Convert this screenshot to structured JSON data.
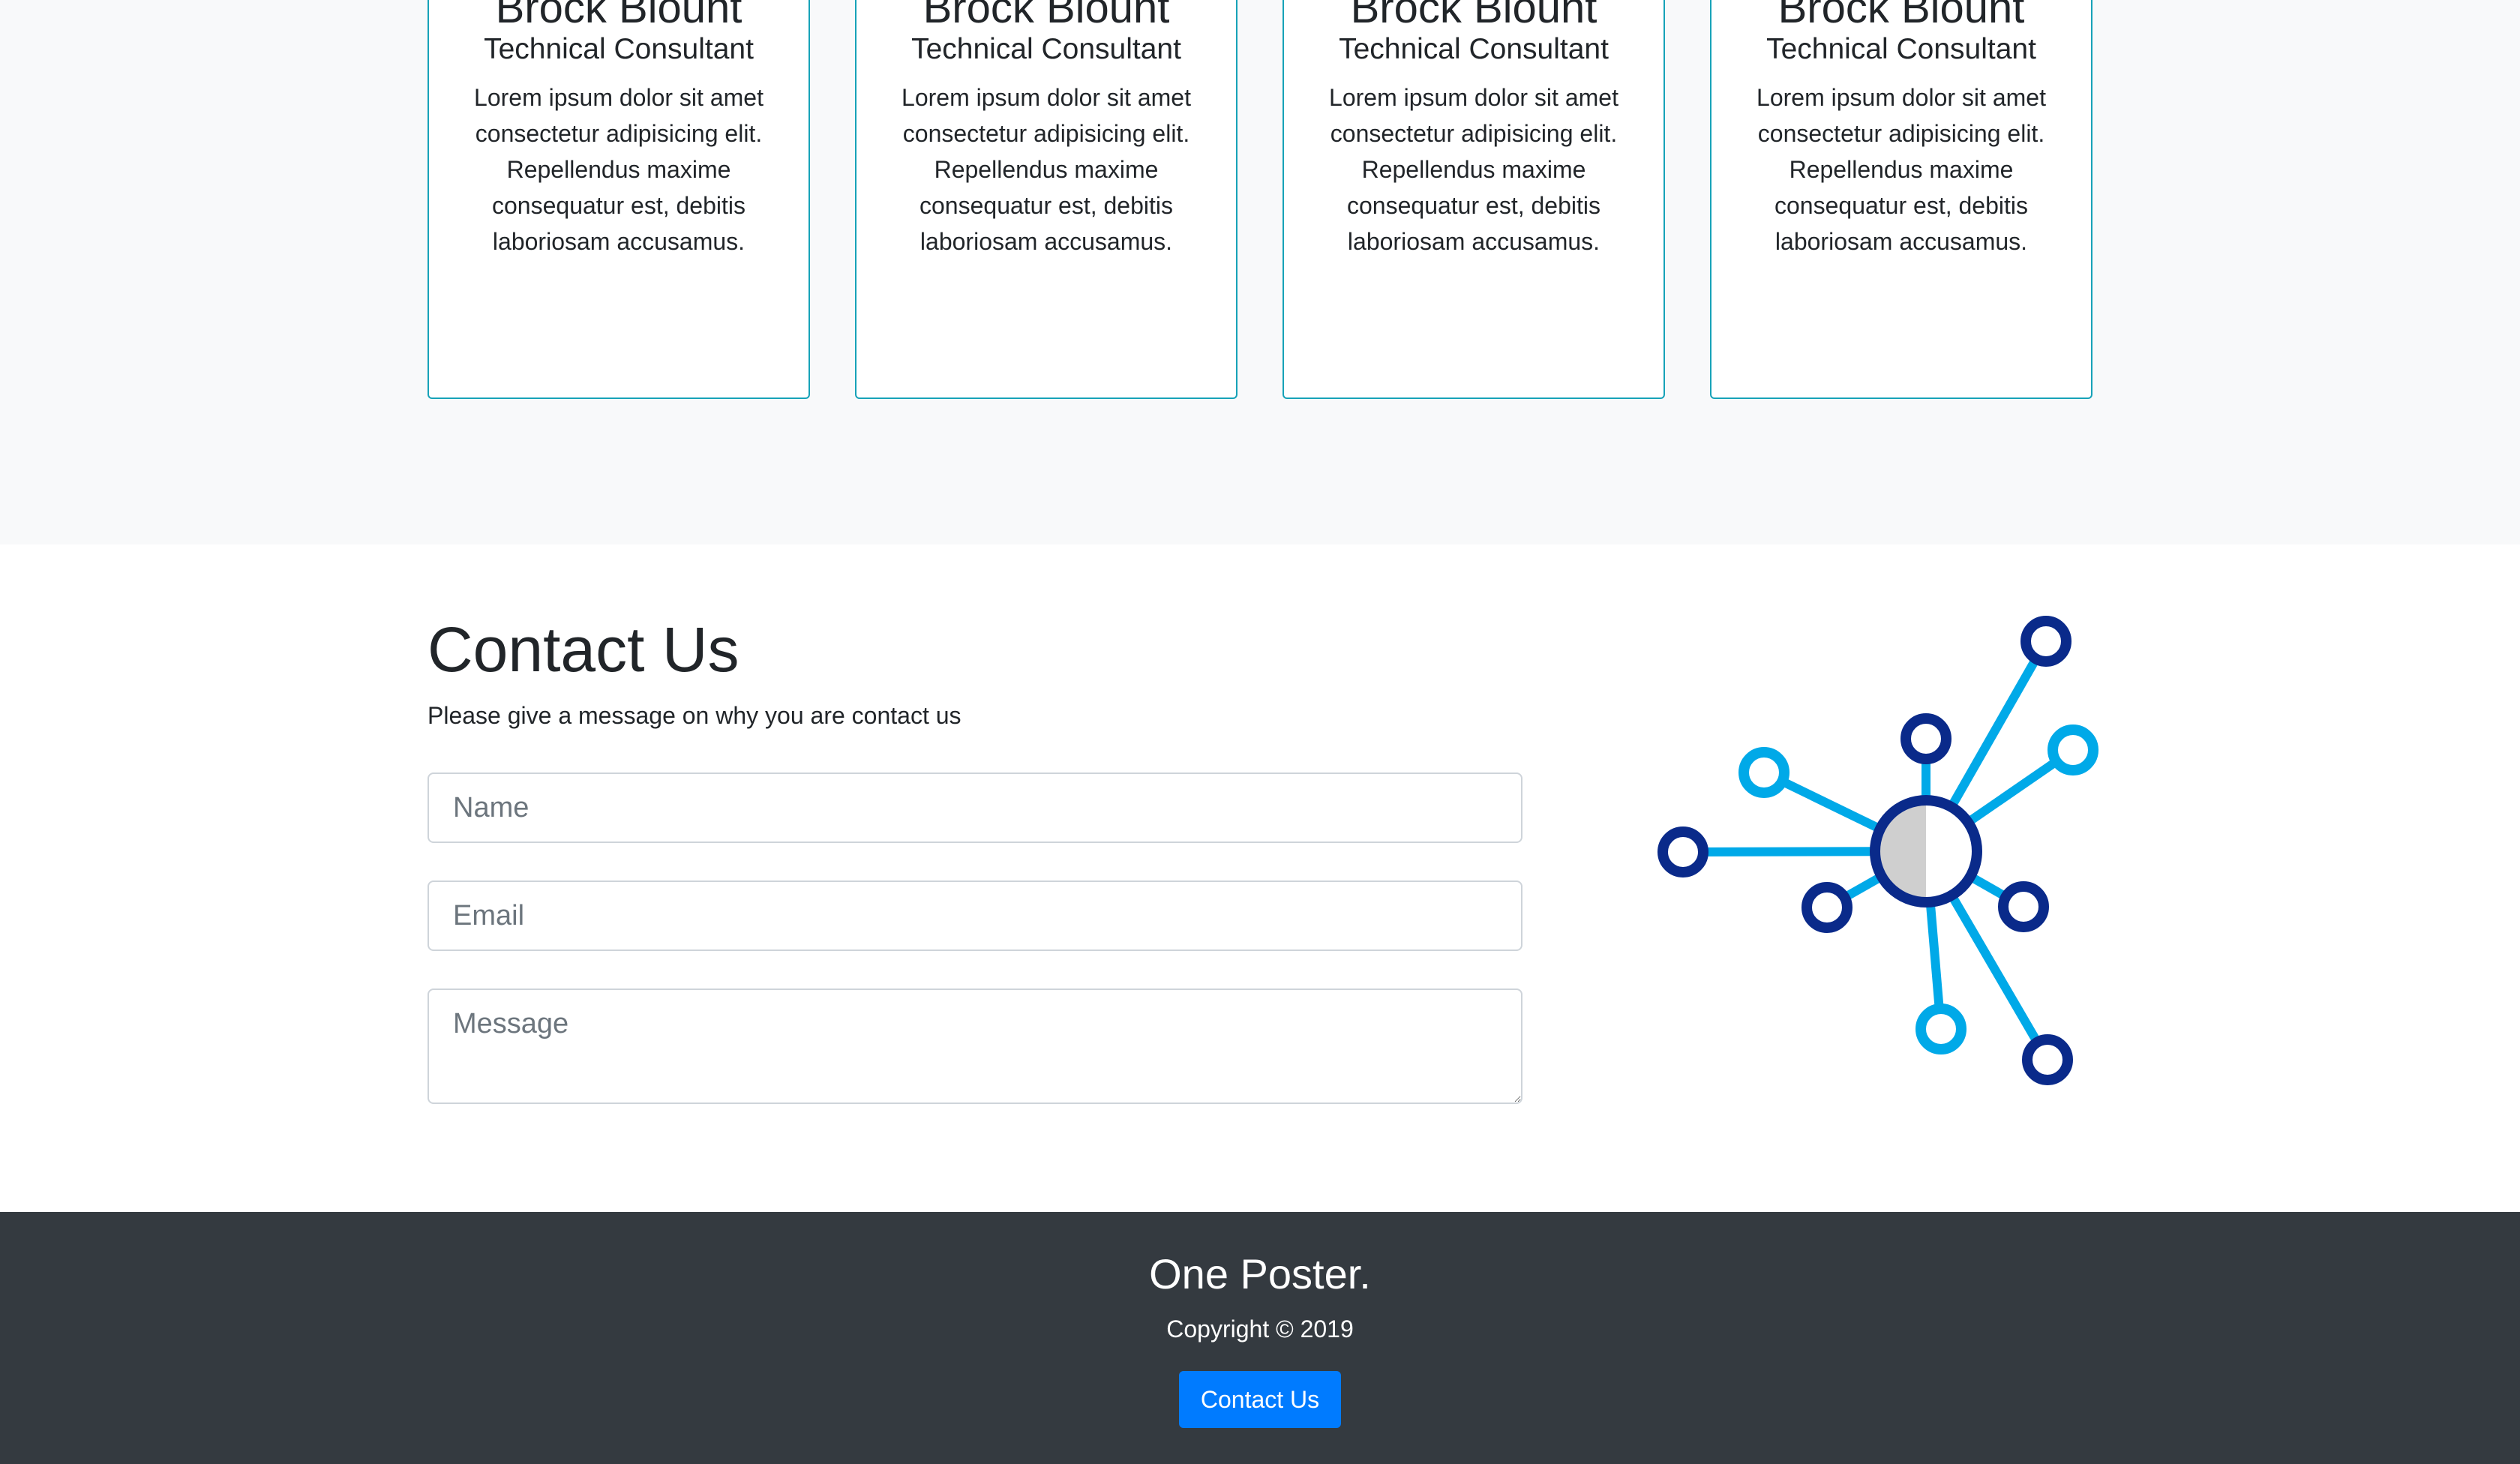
{
  "team": {
    "cards": [
      {
        "name": "Brock Blount",
        "role": "Technical Consultant",
        "text": "Lorem ipsum dolor sit amet consectetur adipisicing elit. Repellendus maxime consequatur est, debitis laboriosam accusamus."
      },
      {
        "name": "Brock Blount",
        "role": "Technical Consultant",
        "text": "Lorem ipsum dolor sit amet consectetur adipisicing elit. Repellendus maxime consequatur est, debitis laboriosam accusamus."
      },
      {
        "name": "Brock Blount",
        "role": "Technical Consultant",
        "text": "Lorem ipsum dolor sit amet consectetur adipisicing elit. Repellendus maxime consequatur est, debitis laboriosam accusamus."
      },
      {
        "name": "Brock Blount",
        "role": "Technical Consultant",
        "text": "Lorem ipsum dolor sit amet consectetur adipisicing elit. Repellendus maxime consequatur est, debitis laboriosam accusamus."
      }
    ]
  },
  "contact": {
    "title": "Contact Us",
    "subtitle": "Please give a message on why you are contact us",
    "name_placeholder": "Name",
    "email_placeholder": "Email",
    "message_placeholder": "Message",
    "illustration_icon": "network-hub-icon"
  },
  "footer": {
    "brand": "One Poster.",
    "copyright": "Copyright © 2019",
    "button_label": "Contact Us"
  },
  "colors": {
    "card_border": "#17a2b8",
    "footer_bg": "#343a40",
    "button_bg": "#007bff",
    "network_dark": "#0a2a8a",
    "network_light": "#00a9e8"
  }
}
